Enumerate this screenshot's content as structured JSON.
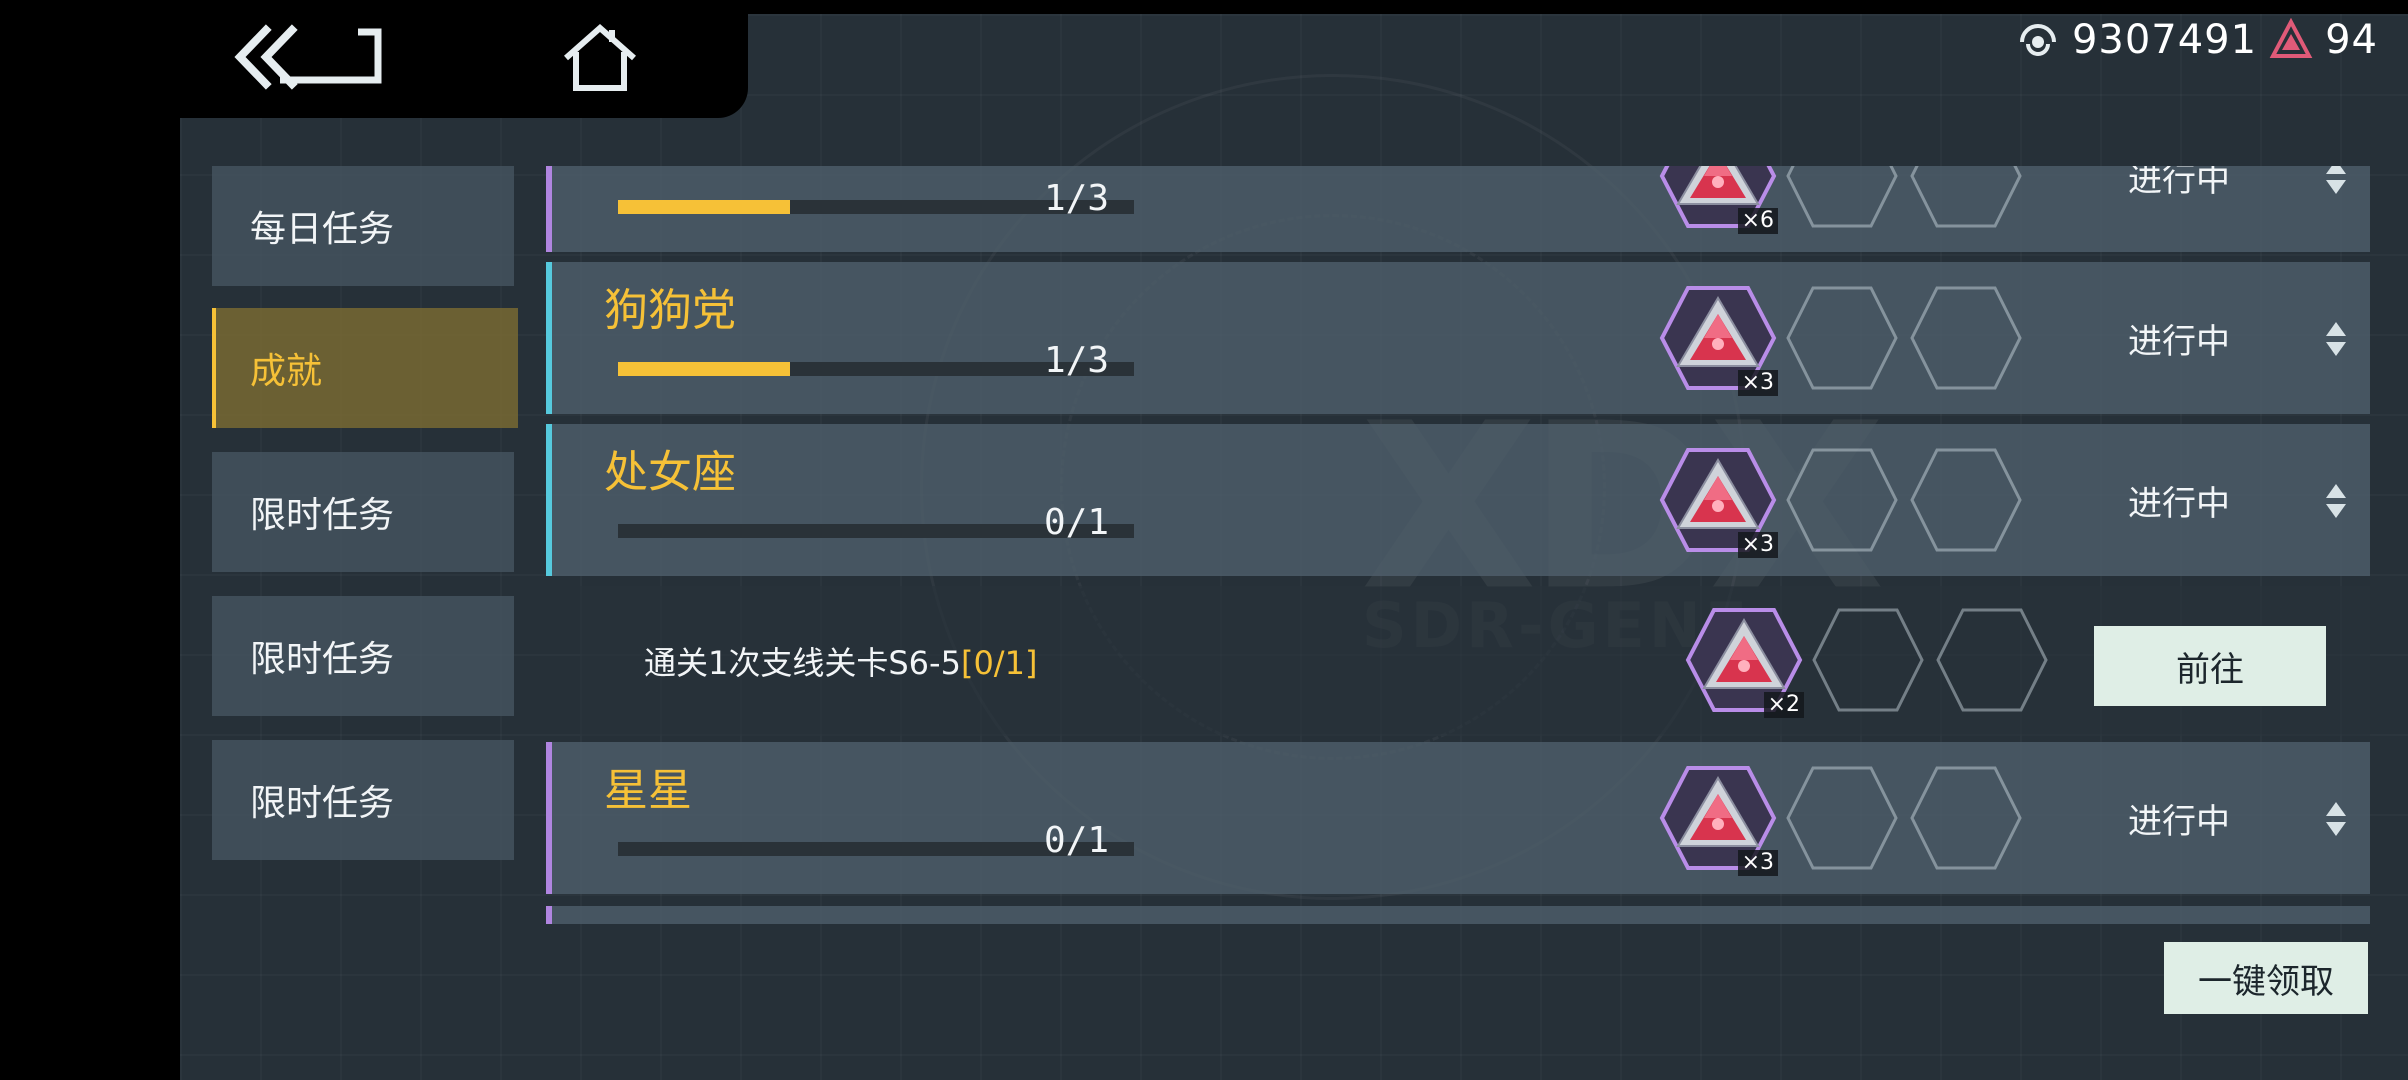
{
  "nav": {
    "back_icon": "double-chevron-back-icon",
    "home_icon": "home-icon"
  },
  "currency": {
    "coins": {
      "icon": "coin-eye-icon",
      "value": "9307491"
    },
    "gems": {
      "icon": "red-triangle-gem-icon",
      "value": "94",
      "color": "#e05a78"
    }
  },
  "sidebar": {
    "items": [
      {
        "label": "每日任务",
        "active": false
      },
      {
        "label": "成就",
        "active": true
      },
      {
        "label": "限时任务",
        "active": false
      },
      {
        "label": "限时任务",
        "active": false
      },
      {
        "label": "限时任务",
        "active": false
      }
    ]
  },
  "tasks": [
    {
      "title": "",
      "progress": 0.333,
      "count": "1/3",
      "reward_qty": "×6",
      "status": "进行中",
      "accent": "#b085e0"
    },
    {
      "title": "狗狗党",
      "progress": 0.333,
      "count": "1/3",
      "reward_qty": "×3",
      "status": "进行中",
      "accent": "#56c9dd"
    },
    {
      "title": "处女座",
      "progress": 0.0,
      "count": "0/1",
      "reward_qty": "×3",
      "status": "进行中",
      "accent": "#56c9dd"
    },
    {
      "title": "星星",
      "progress": 0.0,
      "count": "0/1",
      "reward_qty": "×3",
      "status": "进行中",
      "accent": "#b085e0"
    }
  ],
  "subtask": {
    "description": "通关1次支线关卡S6-5",
    "progress": "[0/1]",
    "reward_qty": "×2",
    "button": "前往"
  },
  "footer": {
    "claim_all": "一键领取"
  },
  "colors": {
    "accent_yellow": "#f6c137",
    "purple": "#b085e0",
    "cyan": "#56c9dd",
    "button_bg": "#dfeee6"
  }
}
